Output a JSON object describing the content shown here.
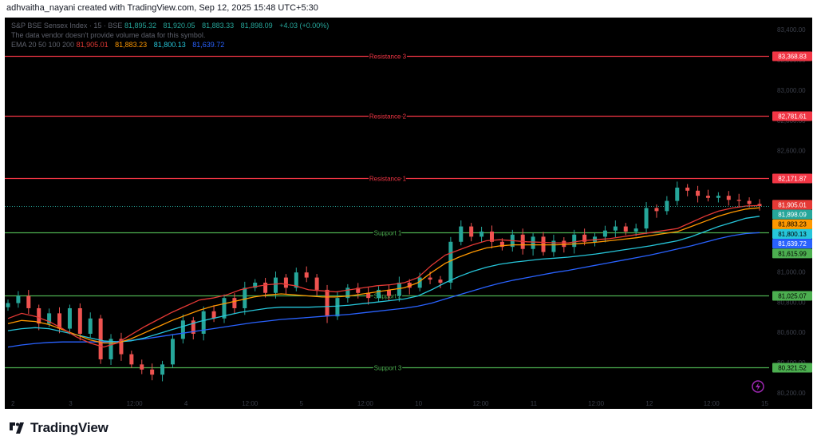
{
  "header": {
    "credit": "adhvaitha_nayani created with TradingView.com, Sep 12, 2025 15:48 UTC+5:30"
  },
  "legend": {
    "line1_text": "S&P BSE Sensex Index · 15 · BSE",
    "line1_values": [
      "81,895.32",
      "81,920.05",
      "81,883.33",
      "81,898.09",
      "+4.03 (+0.00%)"
    ],
    "line2_text": "The data vendor doesn't provide volume data for this symbol.",
    "line3_text": "EMA 20 50 100 200",
    "line3_values": [
      "81,905.01",
      "81,883.23",
      "81,800.13",
      "81,639.72"
    ]
  },
  "branding": {
    "name": "TradingView"
  },
  "colors": {
    "background": "#000000",
    "resistance": "#f23645",
    "support": "#4caf50",
    "candle_up": "#26a69a",
    "candle_down": "#ef5350",
    "ema20": "#e53935",
    "ema50": "#ff9800",
    "ema100": "#26c6da",
    "ema200": "#2962ff",
    "lastprice": "#26a69a"
  },
  "chart_data": {
    "type": "candlestick",
    "symbol": "S&P BSE Sensex Index",
    "interval": "15",
    "y_axis_ticks": [
      "83,400.00",
      "83,300.00",
      "83,000.00",
      "82,800.00",
      "82,600.00",
      "82,400.00",
      "82,000.00",
      "81,200.00",
      "81,000.00",
      "80,800.00",
      "80,600.00",
      "80,400.00",
      "80,200.00"
    ],
    "x_axis_ticks": [
      "2",
      "3",
      "12:00",
      "4",
      "12:00",
      "5",
      "12:00",
      "10",
      "12:00",
      "11",
      "12:00",
      "12",
      "12:00",
      "15"
    ],
    "levels": [
      {
        "name": "Resistance 3",
        "value": 83368.83,
        "value_label": "83,368.83",
        "kind": "resistance"
      },
      {
        "name": "Resistance 2",
        "value": 82781.61,
        "value_label": "82,781.61",
        "kind": "resistance"
      },
      {
        "name": "Resistance 1",
        "value": 82171.87,
        "value_label": "82,171.87",
        "kind": "resistance"
      },
      {
        "name": "Support 1",
        "value": 81639.72,
        "value_label": "81,615.99",
        "kind": "support"
      },
      {
        "name": "Support 2",
        "value": 81025.07,
        "value_label": "81,025.07",
        "kind": "support"
      },
      {
        "name": "Support 3",
        "value": 80321.52,
        "value_label": "80,321.52",
        "kind": "support"
      }
    ],
    "price_labels": [
      {
        "name": "EMA 20",
        "value": 81905.01,
        "label": "81,905.01"
      },
      {
        "name": "Last",
        "value": 81898.09,
        "label": "81,898.09"
      },
      {
        "name": "EMA 50",
        "value": 81883.23,
        "label": "81,883.23"
      },
      {
        "name": "EMA 100",
        "value": 81800.13,
        "label": "81,800.13"
      },
      {
        "name": "EMA 200",
        "value": 81639.72,
        "label": "81,639.72"
      },
      {
        "name": "Support 1",
        "value": 81615.99,
        "label": "81,615.99"
      }
    ],
    "last_price": 81898.09,
    "close_path": [
      80950,
      81020,
      80900,
      80750,
      80850,
      80700,
      80900,
      80650,
      80800,
      80400,
      80600,
      80450,
      80350,
      80300,
      80250,
      80350,
      80600,
      80780,
      80650,
      80870,
      80800,
      81000,
      80900,
      81100,
      81150,
      81050,
      81200,
      81100,
      81250,
      81200,
      81080,
      80820,
      81000,
      81100,
      81050,
      81000,
      81080,
      81020,
      81150,
      81100,
      81200,
      81180,
      81150,
      81550,
      81700,
      81600,
      81650,
      81550,
      81500,
      81620,
      81480,
      81600,
      81450,
      81560,
      81500,
      81620,
      81550,
      81600,
      81660,
      81700,
      81650,
      81680,
      81880,
      81850,
      81950,
      82080,
      82050,
      82000,
      81980,
      82000,
      81960,
      81950,
      81920,
      81900
    ],
    "ema20_path": [
      80800,
      80850,
      80820,
      80770,
      80700,
      80620,
      80560,
      80520,
      80560,
      80640,
      80720,
      80790,
      80860,
      80920,
      80980,
      81000,
      81030,
      81080,
      81110,
      81130,
      81140,
      81120,
      81080,
      81070,
      81060,
      81080,
      81100,
      81120,
      81130,
      81150,
      81200,
      81320,
      81420,
      81470,
      81520,
      81560,
      81570,
      81560,
      81550,
      81545,
      81540,
      81540,
      81560,
      81570,
      81580,
      81600,
      81620,
      81640,
      81660,
      81680,
      81740,
      81800,
      81850,
      81880,
      81900,
      81905
    ],
    "ema50_path": [
      80750,
      80780,
      80770,
      80740,
      80690,
      80640,
      80590,
      80560,
      80560,
      80600,
      80660,
      80720,
      80780,
      80830,
      80880,
      80920,
      80950,
      80980,
      81010,
      81030,
      81040,
      81030,
      81020,
      81010,
      81010,
      81020,
      81040,
      81060,
      81080,
      81100,
      81150,
      81250,
      81340,
      81400,
      81450,
      81490,
      81510,
      81520,
      81520,
      81520,
      81520,
      81525,
      81535,
      81545,
      81560,
      81575,
      81590,
      81610,
      81630,
      81650,
      81700,
      81750,
      81800,
      81840,
      81870,
      81883
    ],
    "ema100_path": [
      80680,
      80700,
      80710,
      80700,
      80670,
      80640,
      80610,
      80580,
      80570,
      80580,
      80610,
      80650,
      80690,
      80730,
      80770,
      80800,
      80830,
      80860,
      80880,
      80900,
      80910,
      80910,
      80910,
      80915,
      80920,
      80930,
      80945,
      80960,
      80975,
      80990,
      81020,
      81080,
      81150,
      81210,
      81260,
      81300,
      81330,
      81350,
      81365,
      81380,
      81390,
      81400,
      81415,
      81430,
      81450,
      81470,
      81490,
      81510,
      81535,
      81560,
      81600,
      81650,
      81700,
      81740,
      81780,
      81800
    ],
    "ema200_path": [
      80520,
      80540,
      80555,
      80565,
      80570,
      80570,
      80570,
      80570,
      80575,
      80585,
      80600,
      80620,
      80640,
      80660,
      80680,
      80700,
      80720,
      80740,
      80760,
      80775,
      80790,
      80800,
      80810,
      80820,
      80830,
      80840,
      80855,
      80870,
      80885,
      80900,
      80920,
      80950,
      80990,
      81030,
      81070,
      81110,
      81145,
      81175,
      81200,
      81225,
      81250,
      81270,
      81295,
      81320,
      81345,
      81370,
      81395,
      81420,
      81450,
      81480,
      81510,
      81545,
      81580,
      81610,
      81630,
      81640
    ]
  }
}
